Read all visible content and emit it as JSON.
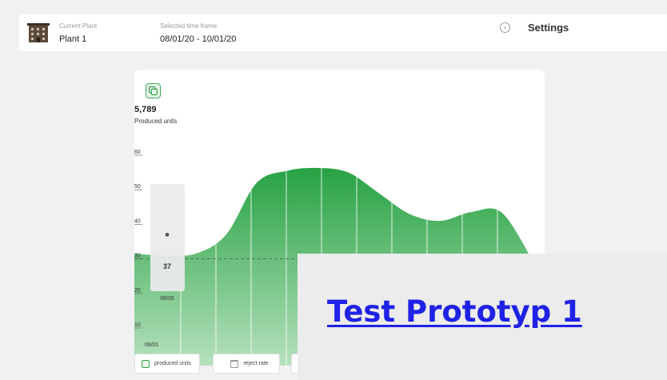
{
  "header": {
    "plant_label": "Current Plant",
    "plant_value": "Plant 1",
    "timeframe_label": "Selected time frame",
    "timeframe_value": "08/01/20 - 10/01/20",
    "settings_label": "Settings"
  },
  "metric": {
    "value": "5,789",
    "label": "Produced units"
  },
  "chart_data": {
    "type": "area",
    "yticks": [
      "10",
      "20",
      "30",
      "40",
      "50",
      "60"
    ],
    "x_labels": [
      "08/01",
      "08/05"
    ],
    "reference_line": 30,
    "series": [
      {
        "values": [
          31.5,
          31,
          31.5,
          37,
          52,
          55.5,
          56.3,
          55,
          49,
          43,
          41,
          43.5,
          43.5,
          30
        ]
      }
    ],
    "tooltip": {
      "value": "37",
      "date": "08/05"
    },
    "colors": {
      "area_top": "#27a243",
      "area_bottom": "#b6e1bd",
      "grid": "#ffffff"
    }
  },
  "buttons": [
    {
      "label": "produced units",
      "icon": "produced-units-icon"
    },
    {
      "label": "reject rate",
      "icon": "trash-icon"
    },
    {
      "label": ""
    }
  ],
  "overlay": {
    "link_text": "Test Prototyp 1"
  }
}
